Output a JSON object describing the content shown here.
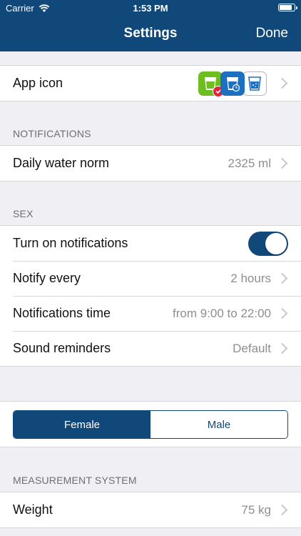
{
  "status": {
    "carrier": "Carrier",
    "time": "1:53 PM",
    "battery_level": 0.95
  },
  "nav": {
    "title": "Settings",
    "done": "Done"
  },
  "app_icon": {
    "label": "App icon",
    "icons": [
      "green-glass-icon",
      "blue-glass-clock-icon",
      "white-glass-icon"
    ]
  },
  "notifications": {
    "header": "NOTIFICATIONS",
    "daily_norm_label": "Daily water norm",
    "daily_norm_value": "2325 ml"
  },
  "sex": {
    "header": "SEX",
    "turn_on_label": "Turn on notifications",
    "turn_on_state": true,
    "notify_every_label": "Notify every",
    "notify_every_value": "2 hours",
    "time_label": "Notifications time",
    "time_value": "from 9:00 to 22:00",
    "sound_label": "Sound reminders",
    "sound_value": "Default"
  },
  "segment": {
    "female": "Female",
    "male": "Male",
    "selected": "Female"
  },
  "measurement": {
    "header": "MEASUREMENT SYSTEM",
    "weight_label": "Weight",
    "weight_value": "75 kg"
  },
  "colors": {
    "brand": "#10487a",
    "background": "#efeff4",
    "icon_green": "#6cbf1e",
    "icon_blue": "#1d70c0"
  }
}
